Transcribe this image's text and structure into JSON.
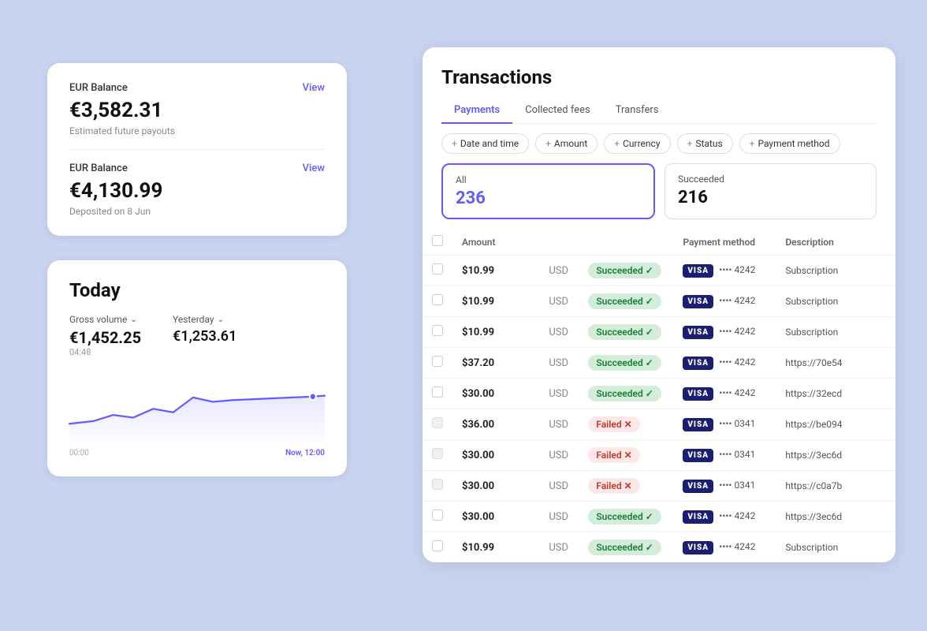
{
  "page": {
    "background": "#c8d4f0"
  },
  "balance_cards": [
    {
      "label": "EUR Balance",
      "view_label": "View",
      "amount": "€3,582.31",
      "sub": "Estimated future payouts"
    },
    {
      "label": "EUR Balance",
      "view_label": "View",
      "amount": "€4,130.99",
      "sub": "Deposited on 8 Jun"
    }
  ],
  "today_card": {
    "title": "Today",
    "gross_volume_label": "Gross volume",
    "yesterday_label": "Yesterday",
    "gross_value": "€1,452.25",
    "gross_time": "04:48",
    "yesterday_value": "€1,253.61",
    "chart_start": "00:00",
    "chart_end": "Now, 12:00"
  },
  "transactions": {
    "title": "Transactions",
    "tabs": [
      {
        "label": "Payments",
        "active": true
      },
      {
        "label": "Collected fees",
        "active": false
      },
      {
        "label": "Transfers",
        "active": false
      }
    ],
    "filters": [
      {
        "label": "Date and time"
      },
      {
        "label": "Amount"
      },
      {
        "label": "Currency"
      },
      {
        "label": "Status"
      },
      {
        "label": "Payment method"
      }
    ],
    "summary": [
      {
        "label": "All",
        "value": "236",
        "selected": true
      },
      {
        "label": "Succeeded",
        "value": "216",
        "selected": false
      }
    ],
    "table_headers": [
      {
        "label": ""
      },
      {
        "label": "Amount"
      },
      {
        "label": ""
      },
      {
        "label": ""
      },
      {
        "label": "Payment method"
      },
      {
        "label": "Description"
      }
    ],
    "rows": [
      {
        "amount": "$10.99",
        "currency": "USD",
        "status": "Succeeded",
        "card_brand": "VISA",
        "card_last4": "4242",
        "description": "Subscription",
        "failed": false
      },
      {
        "amount": "$10.99",
        "currency": "USD",
        "status": "Succeeded",
        "card_brand": "VISA",
        "card_last4": "4242",
        "description": "Subscription",
        "failed": false
      },
      {
        "amount": "$10.99",
        "currency": "USD",
        "status": "Succeeded",
        "card_brand": "VISA",
        "card_last4": "4242",
        "description": "Subscription",
        "failed": false
      },
      {
        "amount": "$37.20",
        "currency": "USD",
        "status": "Succeeded",
        "card_brand": "VISA",
        "card_last4": "4242",
        "description": "https://70e54",
        "failed": false
      },
      {
        "amount": "$30.00",
        "currency": "USD",
        "status": "Succeeded",
        "card_brand": "VISA",
        "card_last4": "4242",
        "description": "https://32ecd",
        "failed": false
      },
      {
        "amount": "$36.00",
        "currency": "USD",
        "status": "Failed",
        "card_brand": "VISA",
        "card_last4": "0341",
        "description": "https://be094",
        "failed": true
      },
      {
        "amount": "$30.00",
        "currency": "USD",
        "status": "Failed",
        "card_brand": "VISA",
        "card_last4": "0341",
        "description": "https://3ec6d",
        "failed": true
      },
      {
        "amount": "$30.00",
        "currency": "USD",
        "status": "Failed",
        "card_brand": "VISA",
        "card_last4": "0341",
        "description": "https://c0a7b",
        "failed": true
      },
      {
        "amount": "$30.00",
        "currency": "USD",
        "status": "Succeeded",
        "card_brand": "VISA",
        "card_last4": "4242",
        "description": "https://3ec6d",
        "failed": false
      },
      {
        "amount": "$10.99",
        "currency": "USD",
        "status": "Succeeded",
        "card_brand": "VISA",
        "card_last4": "4242",
        "description": "Subscription",
        "failed": false
      }
    ]
  }
}
